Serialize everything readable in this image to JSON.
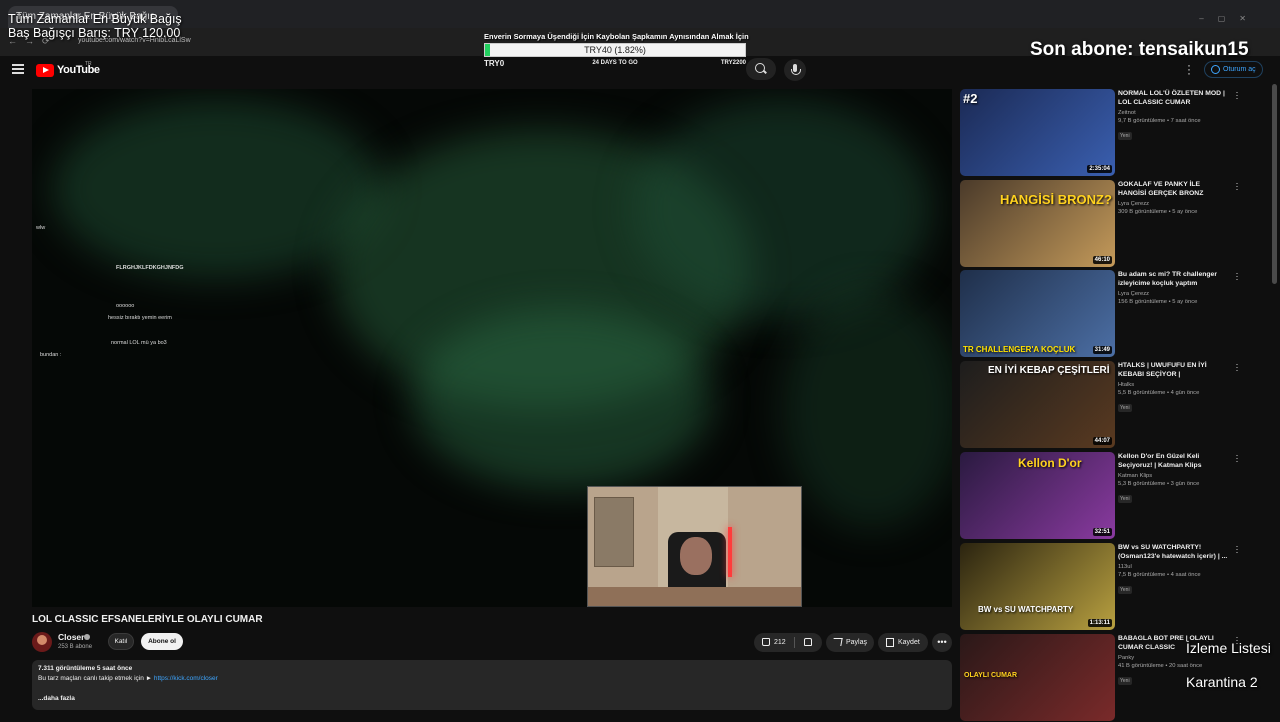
{
  "browser": {
    "tab_title": "Tüm Zamanlar En Büyük Bağış",
    "url": "youtube.com/watch?v=HnlbLcaLlSw"
  },
  "header": {
    "logo_text": "YouTube",
    "country_code": "TR",
    "signin_label": "Oturum aç"
  },
  "overlay": {
    "donor_title": "Tüm Zamanlar En Büyük Bağış",
    "donor_line": "Baş Bağışçı Barış: TRY 120.00",
    "goal_title": "Enverin Sormaya Üşendiği İçin Kaybolan Şapkamın Aynısından Almak İçin",
    "goal_value": "TRY40 (1.82%)",
    "goal_progress_pct": 1.82,
    "goal_start": "TRY0",
    "goal_days": "24 DAYS TO GO",
    "goal_target": "TRY2200",
    "last_sub": "Son abone: tensaikun15",
    "watchlist_title": "İzleme Listesi",
    "watchlist_item": "Karantina 2"
  },
  "chat": [
    "wlw",
    "FLRGHJKLFDKGHJNFDG",
    "oooooo",
    "hessiz bıraktı yemin eerim",
    "normal LOL mü ya bo3",
    "bundan :"
  ],
  "video": {
    "title": "LOL CLASSIC EFSANELERİYLE OLAYLI CUMAR",
    "channel": "Closer",
    "subscribers": "253 B abone",
    "join_label": "Katıl",
    "subscribe_label": "Abone ol",
    "likes": "212",
    "share_label": "Paylaş",
    "save_label": "Kaydet",
    "more_label": "•••",
    "views_line": "7.311 görüntüleme  5 saat önce",
    "desc_text": "Bu tarz maçları canlı takip etmek için ► ",
    "desc_link": "https://kick.com/closer",
    "more_desc": "...daha fazla"
  },
  "sidebar": [
    {
      "title": "NORMAL LOL'Ü ÖZLETEN MOD | LOL CLASSIC CUMAR",
      "channel": "Zeitnot",
      "stats": "9,7 B görüntüleme • 7 saat önce",
      "badge": "Yeni",
      "duration": "2:35:04",
      "thumb_text": "#2"
    },
    {
      "title": "GOKALAF VE PANKY İLE HANGİSİ GERÇEK BRONZ",
      "channel": "Lyra Çerezz",
      "stats": "309 B görüntüleme • 5 ay önce",
      "badge": "",
      "duration": "46:10",
      "thumb_text": "HANGİSİ BRONZ?"
    },
    {
      "title": "Bu adam sc mi? TR challenger izleyicime koçluk yaptım",
      "channel": "Lyra Çerezz",
      "stats": "156 B görüntüleme • 5 ay önce",
      "badge": "",
      "duration": "31:49",
      "thumb_text": "TR CHALLENGER'A KOÇLUK"
    },
    {
      "title": "HTALKS | UWUFUFU EN İYİ KEBABI SEÇİYOR | GÜNCELLENMİŞ VİDEO",
      "channel": "Htalks",
      "stats": "5,5 B görüntüleme • 4 gün önce",
      "badge": "Yeni",
      "duration": "44:07",
      "thumb_text": "EN İYİ KEBAP ÇEŞİTLERİ"
    },
    {
      "title": "Kellon D'or En Güzel Keli Seçiyoruz! | Katman Klips",
      "channel": "Katman Klips",
      "stats": "5,3 B görüntüleme • 3 gün önce",
      "badge": "Yeni",
      "duration": "32:51",
      "thumb_text": "Kellon D'or"
    },
    {
      "title": "BW vs SU WATCHPARTY! (Osman123'e hatewatch içerir) | ...",
      "channel": "113ul",
      "stats": "7,5 B görüntüleme • 4 saat önce",
      "badge": "Yeni",
      "duration": "1:13:11",
      "thumb_text": "BW vs SU WATCHPARTY"
    },
    {
      "title": "BABAGLA BOT PRE | OLAYLI CUMAR CLASSIC",
      "channel": "Panky",
      "stats": "41 B görüntüleme • 20 saat önce",
      "badge": "Yeni",
      "duration": "",
      "thumb_text": "OLAYLI CUMAR"
    }
  ],
  "colors": {
    "accent_red": "#ff0000",
    "link_blue": "#3ea6ff",
    "goal_green": "#23d160",
    "background": "#0f0f0f"
  }
}
